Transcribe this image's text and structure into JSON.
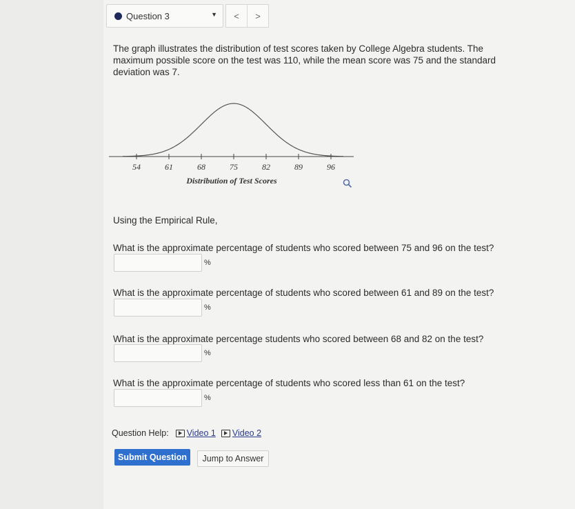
{
  "question_nav": {
    "label": "Question 3",
    "prev": "<",
    "next": ">"
  },
  "prompt": "The graph illustrates the distribution of test scores taken by College Algebra students. The maximum possible score on the test was 110, while the mean score was 75 and the standard deviation was 7.",
  "graph": {
    "ticks": [
      "54",
      "61",
      "68",
      "75",
      "82",
      "89",
      "96"
    ],
    "caption": "Distribution of Test Scores"
  },
  "rule_text": "Using the Empirical Rule,",
  "questions": [
    {
      "text": "What is the approximate percentage of students who scored between 75 and 96 on the test?",
      "value": "",
      "unit": "%"
    },
    {
      "text": "What is the approximate percentage of students who scored between 61 and 89 on the test?",
      "value": "",
      "unit": "%"
    },
    {
      "text": "What is the approximate percentage students who scored between 68 and 82 on the test?",
      "value": "",
      "unit": "%"
    },
    {
      "text": "What is the approximate percentage of students who scored less than 61 on the test?",
      "value": "",
      "unit": "%"
    }
  ],
  "help": {
    "label": "Question Help:",
    "video1": "Video 1",
    "video2": "Video 2"
  },
  "buttons": {
    "submit": "Submit Question",
    "jump": "Jump to Answer"
  },
  "colors": {
    "primary": "#2f6fce",
    "nav_dot": "#1e2a5a"
  }
}
